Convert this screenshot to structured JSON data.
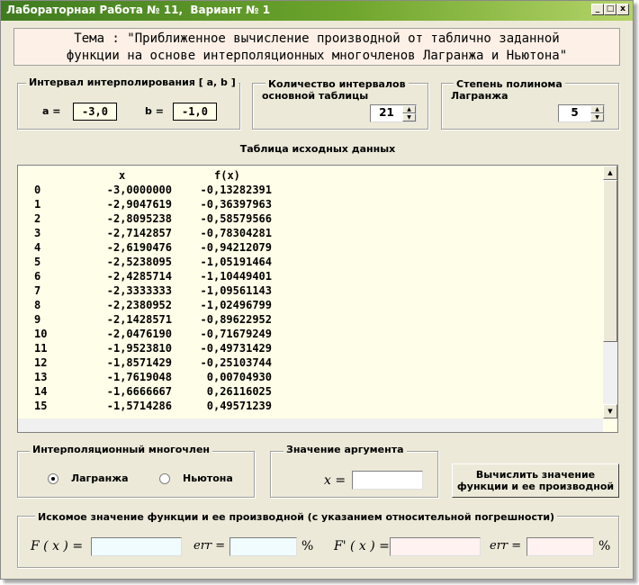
{
  "window": {
    "title": "Лабораторная Работа № 11,  Вариант № 1",
    "minimize": "_",
    "maximize": "□",
    "close": "x"
  },
  "theme": {
    "line1": "Тема : \"Приближенное вычисление производной от таблично заданной",
    "line2": "функции на основе интерполяционных многочленов Лагранжа и Ньютона\""
  },
  "interval": {
    "label": "Интервал интерполирования  [ a, b ]",
    "a_label": "a =",
    "a_value": "-3,0",
    "b_label": "b =",
    "b_value": "-1,0"
  },
  "count": {
    "label_line1": "Количество интервалов",
    "label_line2": "основной таблицы",
    "value": "21"
  },
  "degree": {
    "label_line1": "Степень полинома",
    "label_line2": "Лагранжа",
    "value": "5"
  },
  "table": {
    "title": "Таблица исходных данных",
    "headers": [
      "x",
      "f(x)"
    ],
    "rows": [
      [
        "0",
        "-3,0000000",
        "-0,13282391"
      ],
      [
        "1",
        "-2,9047619",
        "-0,36397963"
      ],
      [
        "2",
        "-2,8095238",
        "-0,58579566"
      ],
      [
        "3",
        "-2,7142857",
        "-0,78304281"
      ],
      [
        "4",
        "-2,6190476",
        "-0,94212079"
      ],
      [
        "5",
        "-2,5238095",
        "-1,05191464"
      ],
      [
        "6",
        "-2,4285714",
        "-1,10449401"
      ],
      [
        "7",
        "-2,3333333",
        "-1,09561143"
      ],
      [
        "8",
        "-2,2380952",
        "-1,02496799"
      ],
      [
        "9",
        "-2,1428571",
        "-0,89622952"
      ],
      [
        "10",
        "-2,0476190",
        "-0,71679249"
      ],
      [
        "11",
        "-1,9523810",
        "-0,49731429"
      ],
      [
        "12",
        "-1,8571429",
        "-0,25103744"
      ],
      [
        "13",
        "-1,7619048",
        "0,00704930"
      ],
      [
        "14",
        "-1,6666667",
        "0,26116025"
      ],
      [
        "15",
        "-1,5714286",
        "0,49571239"
      ]
    ]
  },
  "polynomial": {
    "label": "Интерполяционный многочлен",
    "option_lagrange": "Лагранжа",
    "option_newton": "Ньютона",
    "selected": "Лагранжа"
  },
  "argument": {
    "label": "Значение аргумента",
    "x_label": "x =",
    "value": ""
  },
  "compute_button": {
    "line1": "Вычислить значение",
    "line2": "функции и ее производной"
  },
  "result": {
    "label": "Искомое значение функции и ее производной (с указанием относительной погрешности)",
    "f_label": "F ( x ) =",
    "err_label": "err =",
    "pct": "%",
    "fd_label": "F' ( x ) =",
    "f_value": "",
    "f_err": "",
    "fd_value": "",
    "fd_err": ""
  },
  "colors": {
    "title_bar_start": "#3f7b1f",
    "title_bar_end": "#b4d468",
    "table_bg": "#fffee8",
    "theme_bg": "#fdf0e6",
    "f_field_bg": "#f0fcff",
    "fd_field_bg": "#fff2f0"
  }
}
